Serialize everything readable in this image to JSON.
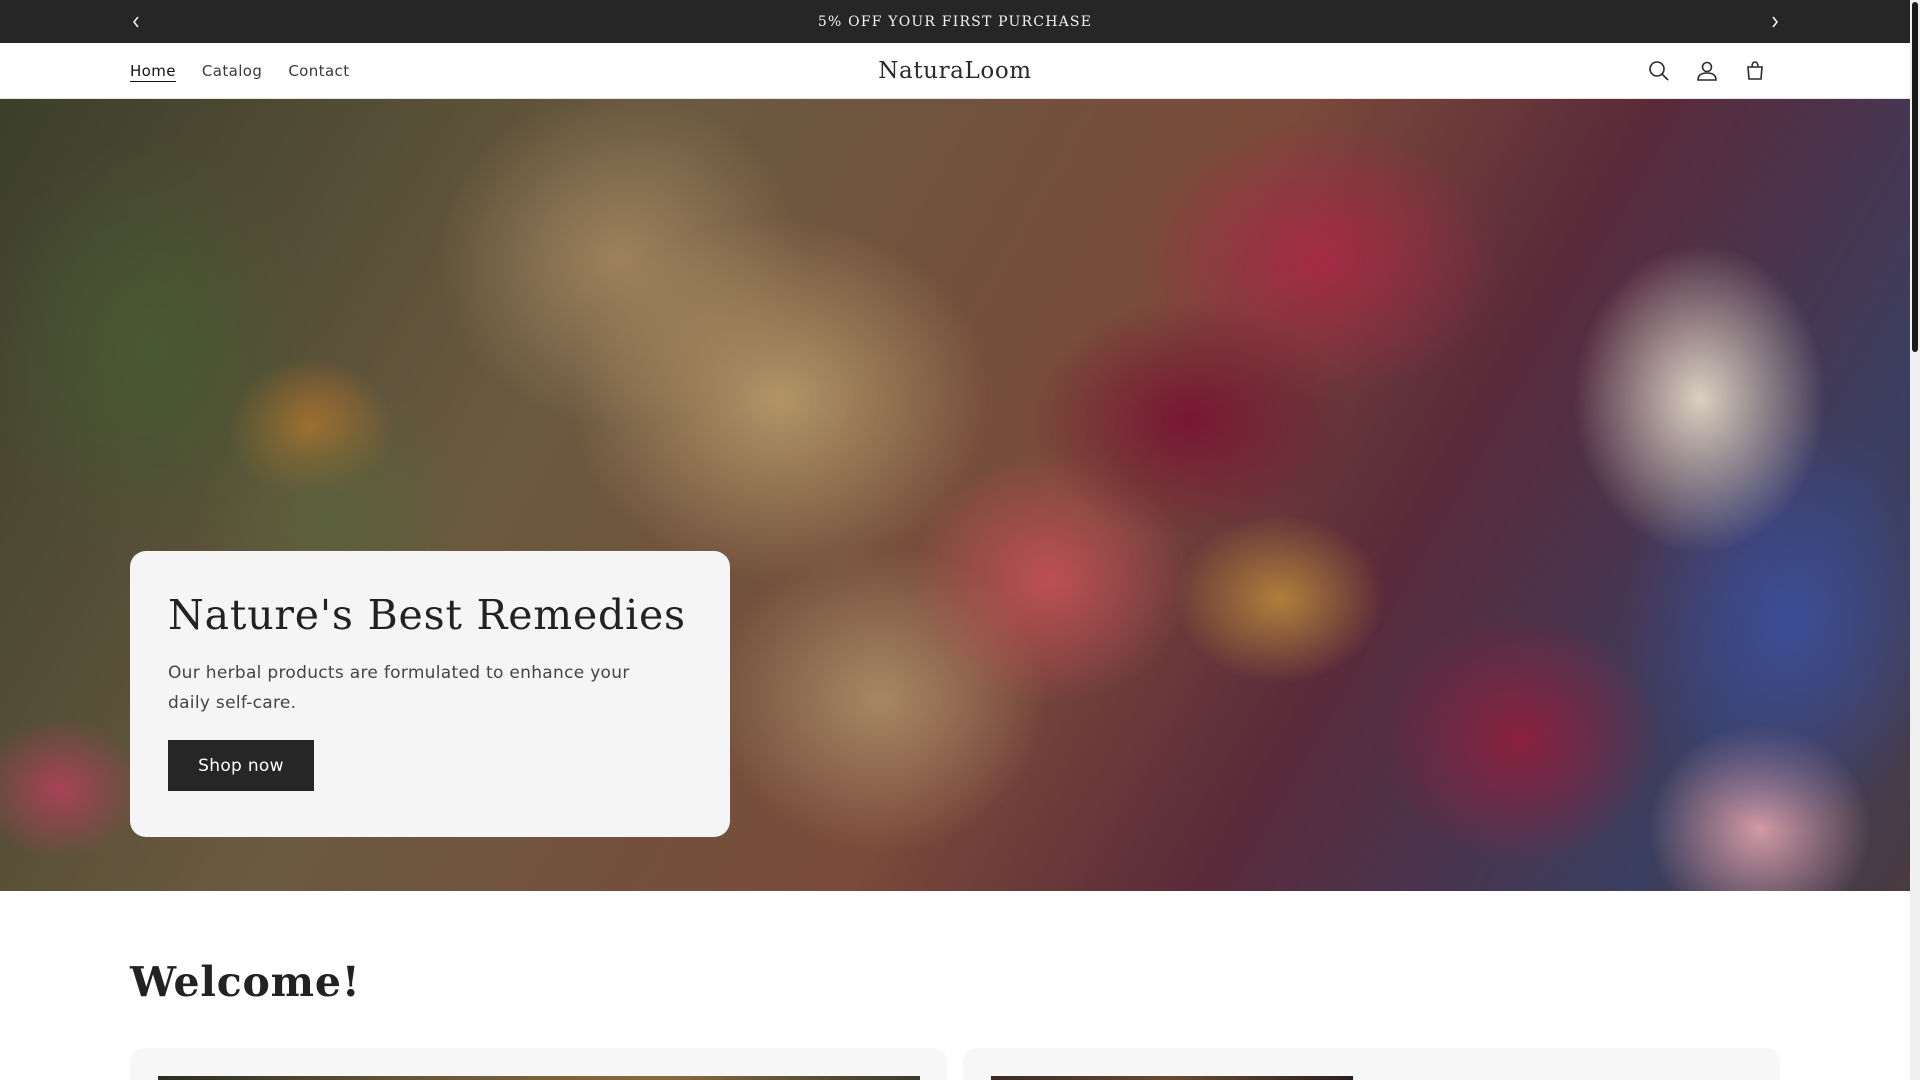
{
  "announcement": {
    "message": "5% OFF YOUR FIRST PURCHASE",
    "prev_icon": "chevron-left-icon",
    "next_icon": "chevron-right-icon"
  },
  "header": {
    "brand": "NaturaLoom",
    "nav": [
      {
        "label": "Home",
        "active": true
      },
      {
        "label": "Catalog",
        "active": false
      },
      {
        "label": "Contact",
        "active": false
      }
    ],
    "icons": [
      "search-icon",
      "account-icon",
      "cart-icon"
    ]
  },
  "hero": {
    "title": "Nature's Best Remedies",
    "subtitle": "Our herbal products are formulated to enhance your daily self-care.",
    "button_label": "Shop now"
  },
  "welcome": {
    "title": "Welcome!"
  },
  "colors": {
    "announcement_bg": "#262626",
    "button_bg": "#262626",
    "card_bg": "#f5f5f5"
  }
}
